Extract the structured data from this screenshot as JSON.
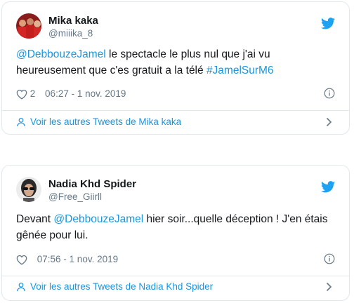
{
  "tweets": [
    {
      "name": "Mika kaka",
      "handle": "@miiika_8",
      "mention": "@DebbouzeJamel",
      "text_line1": " le spectacle le plus nul que j'ai vu",
      "text_line2": "heureusement que c'es gratuit a la télé ",
      "hashtag": "#JamelSurM6",
      "likes": "2",
      "time": "06:27 - 1 nov. 2019",
      "more_label": "Voir les autres Tweets de Mika kaka"
    },
    {
      "name": "Nadia Khd Spider",
      "handle": "@Free_Giirll",
      "prefix": "Devant ",
      "mention": "@DebbouzeJamel",
      "text_line1": " hier soir...quelle déception ! J'en étais",
      "text_line2": "gênée pour lui.",
      "time": "07:56 - 1 nov. 2019",
      "more_label": "Voir les autres Tweets de Nadia Khd Spider"
    }
  ],
  "colors": {
    "link": "#1b95e0",
    "muted": "#657786",
    "border": "#e1e8ed"
  },
  "icons": [
    "twitter-bird-icon",
    "heart-icon",
    "info-icon",
    "person-icon",
    "chevron-right-icon"
  ]
}
